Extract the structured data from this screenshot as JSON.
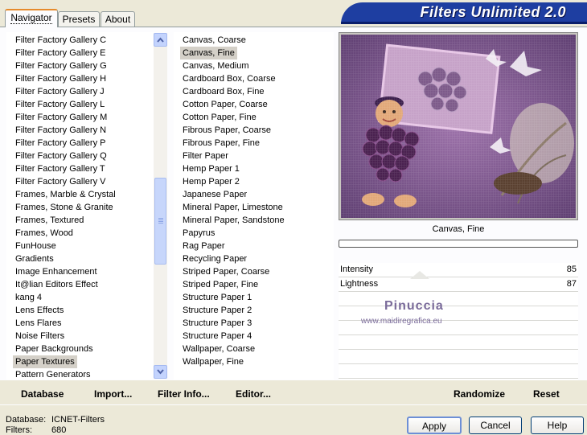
{
  "tabs": [
    {
      "label": "Navigator",
      "active": true
    },
    {
      "label": "Presets",
      "active": false
    },
    {
      "label": "About",
      "active": false
    }
  ],
  "banner": {
    "title": "Filters Unlimited 2.0"
  },
  "categories": {
    "items": [
      "Filter Factory Gallery C",
      "Filter Factory Gallery E",
      "Filter Factory Gallery G",
      "Filter Factory Gallery H",
      "Filter Factory Gallery J",
      "Filter Factory Gallery L",
      "Filter Factory Gallery M",
      "Filter Factory Gallery N",
      "Filter Factory Gallery P",
      "Filter Factory Gallery Q",
      "Filter Factory Gallery T",
      "Filter Factory Gallery V",
      "Frames, Marble & Crystal",
      "Frames, Stone & Granite",
      "Frames, Textured",
      "Frames, Wood",
      "FunHouse",
      "Gradients",
      "Image Enhancement",
      "It@lian Editors Effect",
      "kang 4",
      "Lens Effects",
      "Lens Flares",
      "Noise Filters",
      "Paper Backgrounds",
      "Paper Textures",
      "Pattern Generators"
    ],
    "selected": "Paper Textures"
  },
  "filters": {
    "items": [
      "Canvas, Coarse",
      "Canvas, Fine",
      "Canvas, Medium",
      "Cardboard Box, Coarse",
      "Cardboard Box, Fine",
      "Cotton Paper, Coarse",
      "Cotton Paper, Fine",
      "Fibrous Paper, Coarse",
      "Fibrous Paper, Fine",
      "Filter Paper",
      "Hemp Paper 1",
      "Hemp Paper 2",
      "Japanese Paper",
      "Mineral Paper, Limestone",
      "Mineral Paper, Sandstone",
      "Papyrus",
      "Rag Paper",
      "Recycling Paper",
      "Striped Paper, Coarse",
      "Striped Paper, Fine",
      "Structure Paper 1",
      "Structure Paper 2",
      "Structure Paper 3",
      "Structure Paper 4",
      "Wallpaper, Coarse",
      "Wallpaper, Fine"
    ],
    "selected": "Canvas, Fine"
  },
  "preview": {
    "filter_name": "Canvas, Fine",
    "progress": 0
  },
  "params": [
    {
      "name": "Intensity",
      "value": "85"
    },
    {
      "name": "Lightness",
      "value": "87"
    }
  ],
  "watermark": {
    "line1": "Pinuccia",
    "line2": "www.maidiregrafica.eu"
  },
  "toolbar": {
    "database": "Database",
    "import": "Import...",
    "filter_info": "Filter Info...",
    "editor": "Editor...",
    "randomize": "Randomize",
    "reset": "Reset"
  },
  "status": {
    "database_label": "Database:",
    "database_value": "ICNET-Filters",
    "filters_label": "Filters:",
    "filters_value": "680"
  },
  "buttons": {
    "apply": "Apply",
    "cancel": "Cancel",
    "help": "Help"
  },
  "colors": {
    "banner": "#1e3ea1",
    "preview_bg": "#8a5a9c",
    "tab_accent": "#e68b2c"
  }
}
